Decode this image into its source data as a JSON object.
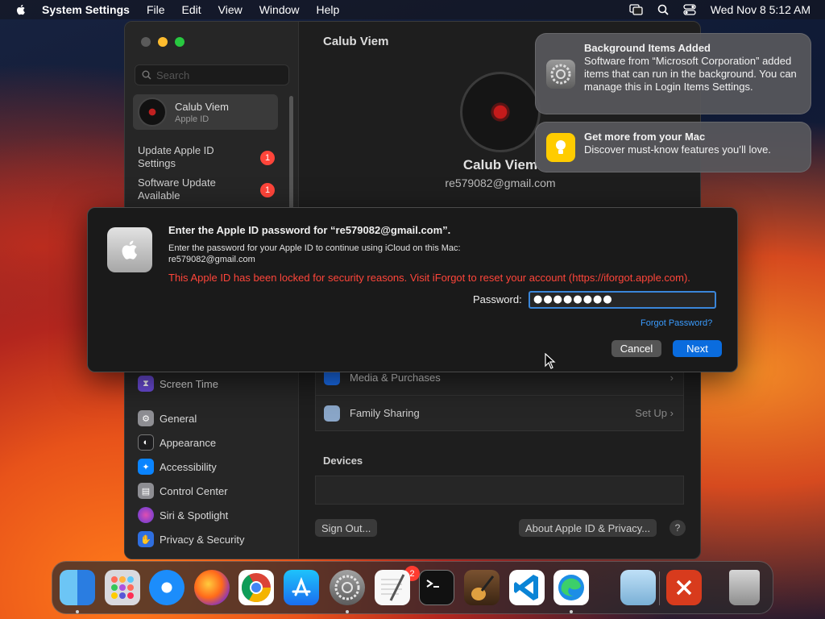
{
  "menubar": {
    "app": "System Settings",
    "items": [
      "File",
      "Edit",
      "View",
      "Window",
      "Help"
    ],
    "clock": "Wed Nov 8  5:12 AM"
  },
  "sidebar": {
    "search_placeholder": "Search",
    "account": {
      "name": "Calub Viem",
      "subtitle": "Apple ID"
    },
    "notices": [
      {
        "label": "Update Apple ID Settings",
        "badge": "1"
      },
      {
        "label": "Software Update Available",
        "badge": "1"
      }
    ],
    "items": [
      {
        "label": "Screen Time",
        "icon": "hourglass-icon",
        "color": "#6a4bd6"
      },
      {
        "label": "General",
        "icon": "gear-icon",
        "color": "#8e8e93"
      },
      {
        "label": "Appearance",
        "icon": "appearance-icon",
        "color": "#1c1c1e"
      },
      {
        "label": "Accessibility",
        "icon": "accessibility-icon",
        "color": "#0a84ff"
      },
      {
        "label": "Control Center",
        "icon": "control-center-icon",
        "color": "#8e8e93"
      },
      {
        "label": "Siri & Spotlight",
        "icon": "siri-icon",
        "color": "#c2379b"
      },
      {
        "label": "Privacy & Security",
        "icon": "hand-icon",
        "color": "#2f6fe0"
      }
    ]
  },
  "main": {
    "title": "Calub Viem",
    "name": "Calub Viem",
    "email": "re579082@gmail.com",
    "rows": [
      {
        "label": "Media & Purchases",
        "right": ""
      },
      {
        "label": "Family Sharing",
        "right": "Set Up"
      }
    ],
    "devices_label": "Devices",
    "sign_out": "Sign Out...",
    "about": "About Apple ID & Privacy...",
    "help": "?"
  },
  "notifications": [
    {
      "title": "Background Items Added",
      "body": "Software from “Microsoft Corporation” added items that can run in the background. You can manage this in Login Items Settings."
    },
    {
      "title": "Get more from your Mac",
      "body": "Discover must-know features you’ll love."
    }
  ],
  "dialog": {
    "title": "Enter the Apple ID password for “re579082@gmail.com”.",
    "text_line1": "Enter the password for your Apple ID to continue using iCloud on this Mac:",
    "text_line2": "re579082@gmail.com",
    "error": "This Apple ID has been locked for security reasons. Visit iForgot to reset your account (https://iforgot.apple.com).",
    "password_label": "Password:",
    "password_value": "●●●●●●●●",
    "forgot": "Forgot Password?",
    "cancel": "Cancel",
    "next": "Next"
  },
  "dock": {
    "badge": "2",
    "apps": [
      "finder-icon",
      "launchpad-icon",
      "safari-icon",
      "firefox-icon",
      "chrome-icon",
      "app-store-icon",
      "system-settings-icon",
      "textedit-icon",
      "terminal-icon",
      "garageband-icon",
      "vscode-icon",
      "edge-icon",
      "preview-icon",
      "remote-desktop-icon",
      "trash-icon"
    ]
  }
}
